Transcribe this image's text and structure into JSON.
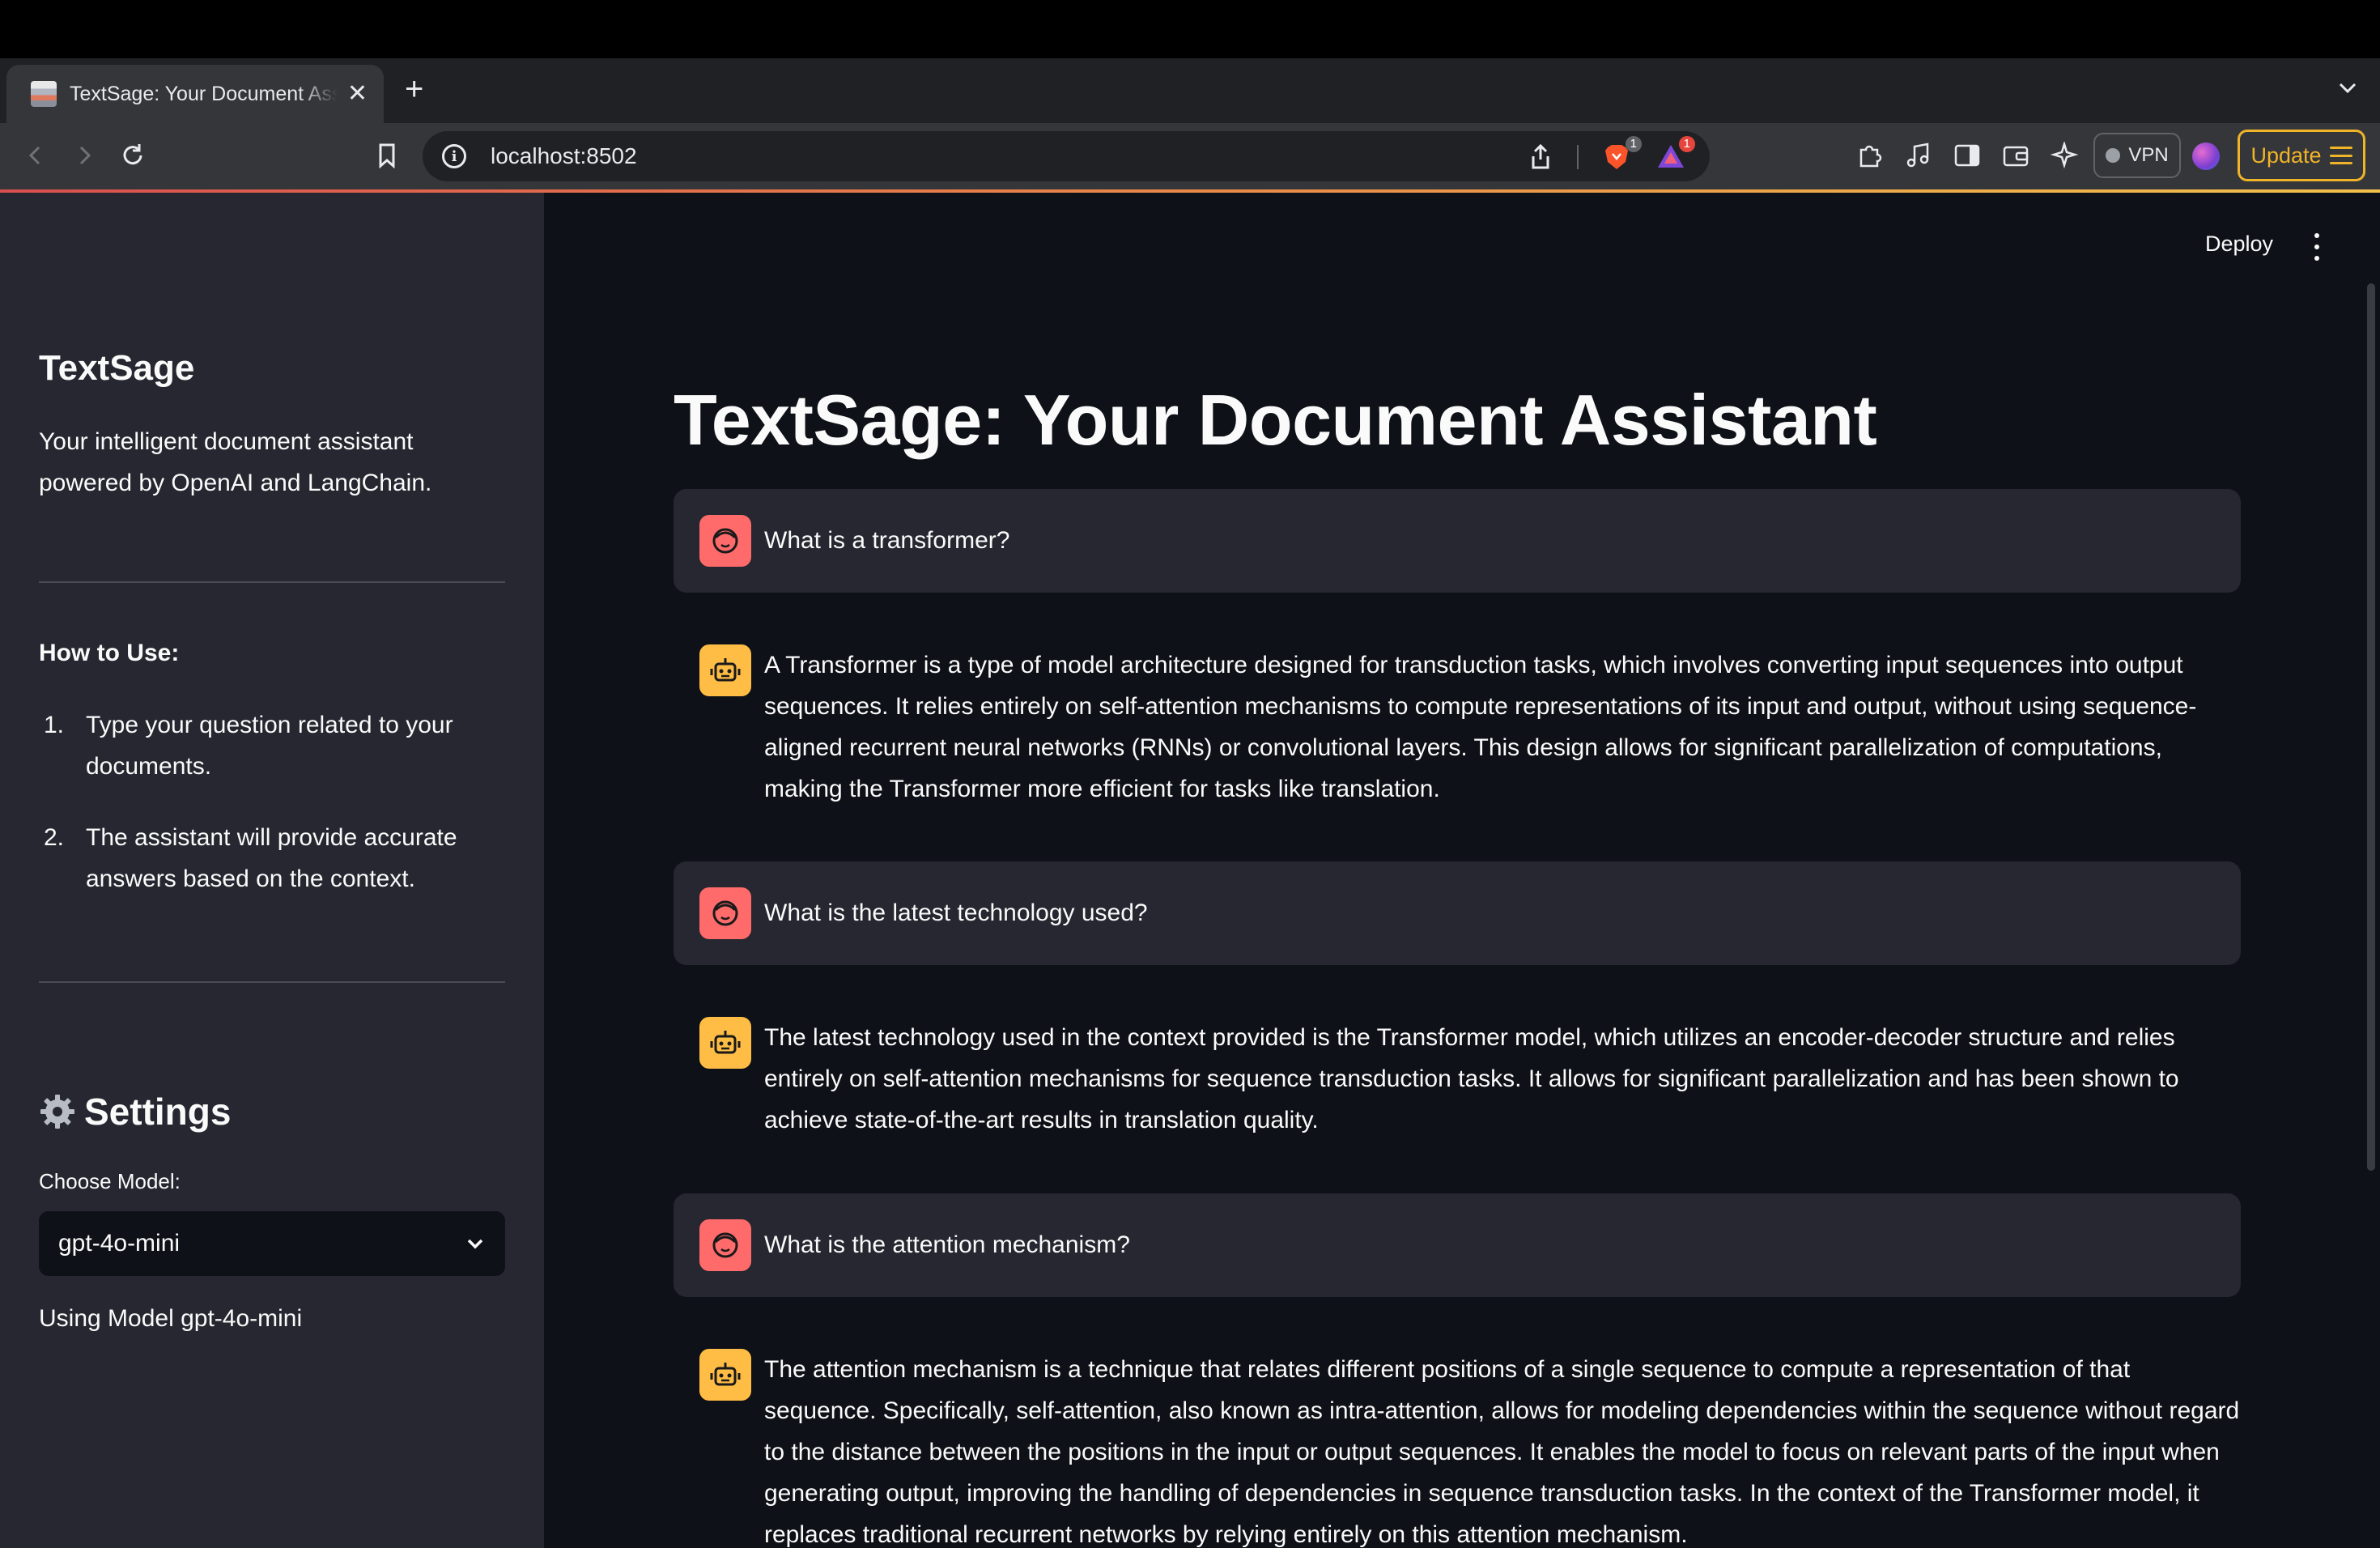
{
  "browser": {
    "tab_title": "TextSage: Your Document Assistant",
    "url": "localhost:8502",
    "brave_badge": "1",
    "rewards_badge": "1",
    "vpn_label": "VPN",
    "update_label": "Update"
  },
  "sidebar": {
    "title": "TextSage",
    "description": "Your intelligent document assistant powered by OpenAI and LangChain.",
    "how_to_heading": "How to Use:",
    "steps": [
      {
        "num": "1.",
        "text": "Type your question related to your documents."
      },
      {
        "num": "2.",
        "text": "The assistant will provide accurate answers based on the context."
      }
    ],
    "settings_heading": "Settings",
    "model_label": "Choose Model:",
    "model_selected": "gpt-4o-mini",
    "using_model_text": "Using Model gpt-4o-mini"
  },
  "header": {
    "deploy_label": "Deploy"
  },
  "main": {
    "title": "TextSage: Your Document Assistant",
    "messages": [
      {
        "role": "user",
        "text": "What is a transformer?"
      },
      {
        "role": "assistant",
        "text": "A Transformer is a type of model architecture designed for transduction tasks, which involves converting input sequences into output sequences. It relies entirely on self-attention mechanisms to compute representations of its input and output, without using sequence-aligned recurrent neural networks (RNNs) or convolutional layers. This design allows for significant parallelization of computations, making the Transformer more efficient for tasks like translation."
      },
      {
        "role": "user",
        "text": "What is the latest technology used?"
      },
      {
        "role": "assistant",
        "text": "The latest technology used in the context provided is the Transformer model, which utilizes an encoder-decoder structure and relies entirely on self-attention mechanisms for sequence transduction tasks. It allows for significant parallelization and has been shown to achieve state-of-the-art results in translation quality."
      },
      {
        "role": "user",
        "text": "What is the attention mechanism?"
      },
      {
        "role": "assistant",
        "text": "The attention mechanism is a technique that relates different positions of a single sequence to compute a representation of that sequence. Specifically, self-attention, also known as intra-attention, allows for modeling dependencies within the sequence without regard to the distance between the positions in the input or output sequences. It enables the model to focus on relevant parts of the input when generating output, improving the handling of dependencies in sequence transduction tasks. In the context of the Transformer model, it replaces traditional recurrent networks by relying entirely on this attention mechanism."
      }
    ]
  },
  "colors": {
    "sidebar_bg": "#262730",
    "main_bg": "#0e1117",
    "user_avatar": "#ff6b6b",
    "assistant_avatar": "#ffbd45",
    "update_accent": "#f0b429"
  }
}
